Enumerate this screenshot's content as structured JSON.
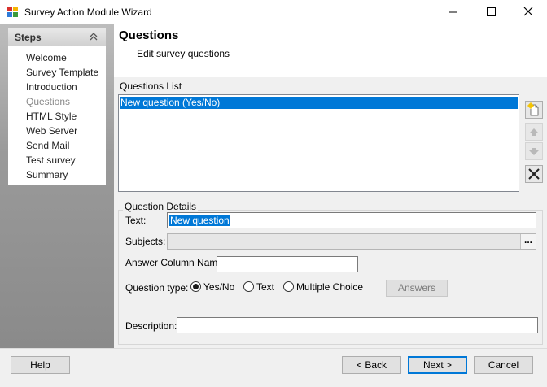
{
  "window": {
    "title": "Survey Action Module Wizard"
  },
  "steps": {
    "title": "Steps",
    "items": [
      "Welcome",
      "Survey Template",
      "Introduction",
      "Questions",
      "HTML Style",
      "Web Server",
      "Send Mail",
      "Test survey",
      "Summary"
    ],
    "current_index": 3
  },
  "header": {
    "title": "Questions",
    "subtitle": "Edit survey questions"
  },
  "questions_list": {
    "label": "Questions List",
    "items": [
      "New question (Yes/No)"
    ],
    "selected_index": 0
  },
  "details": {
    "group_label": "Question Details",
    "text_label": "Text:",
    "text_value": "New question",
    "subjects_label": "Subjects:",
    "subjects_button": "...",
    "answer_column_label": "Answer Column Name:",
    "answer_column_value": "",
    "question_type_label": "Question type:",
    "types": [
      {
        "label": "Yes/No",
        "checked": true
      },
      {
        "label": "Text",
        "checked": false
      },
      {
        "label": "Multiple Choice",
        "checked": false
      }
    ],
    "answers_button": "Answers",
    "description_label": "Description:",
    "description_value": ""
  },
  "footer": {
    "help": "Help",
    "back": "< Back",
    "next": "Next >",
    "cancel": "Cancel"
  },
  "colors": {
    "selection": "#0078d7",
    "window_bg": "#f0f0f0"
  }
}
